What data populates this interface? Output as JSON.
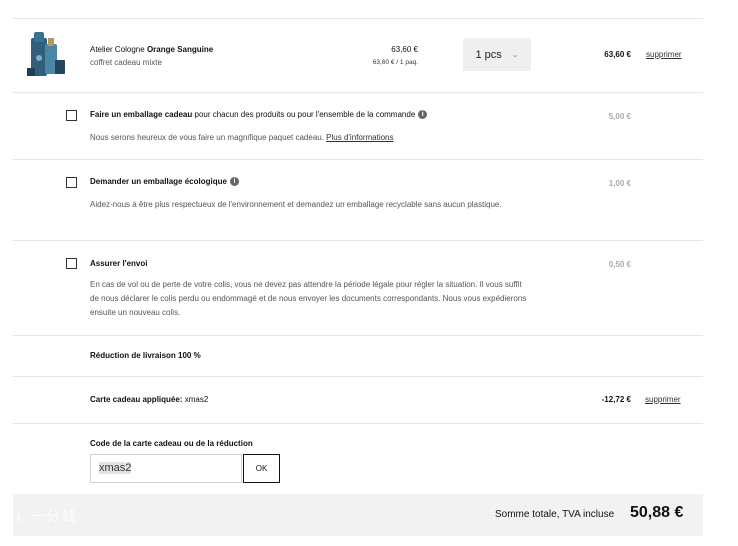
{
  "product": {
    "brand": "Atelier Cologne",
    "name": "Orange Sanguine",
    "subtitle": "coffret cadeau mixte",
    "unit_price": "63,60 €",
    "unit_price_detail": "63,60 € / 1 paq.",
    "quantity": "1 pcs",
    "line_total": "63,60 €",
    "remove_label": "supprimer"
  },
  "options": [
    {
      "title": "Faire un emballage cadeau",
      "title_rest": " pour chacun des produits ou pour l'ensemble de la commande",
      "description": "Nous serons heureux de vous faire un magnifique paquet cadeau.",
      "link": "Plus d'informations",
      "price": "5,00 €"
    },
    {
      "title": "Demander un emballage écologique",
      "description": "Aidez-nous à être plus respectueux de l'environnement et demandez un emballage recyclable sans aucun plastique.",
      "price": "1,00 €"
    },
    {
      "title": "Assurer l'envoi",
      "description": "En cas de vol ou de perte de votre colis, vous ne devez pas attendre la période légale pour régler la situation. Il vous suffit de nous déclarer le colis perdu ou endommagé et de nous envoyer les documents correspondants. Nous vous expédierons ensuite un nouveau colis.",
      "price": "0,50 €"
    }
  ],
  "shipping_discount": "Réduction de livraison 100 %",
  "gift_card": {
    "label": "Carte cadeau appliquée:",
    "code": "xmas2",
    "amount": "-12,72 €",
    "remove_label": "supprimer"
  },
  "code_entry": {
    "label": "Code de la carte cadeau ou de la réduction",
    "value": "xmas2",
    "ok_label": "OK"
  },
  "total": {
    "label": "Somme totale, TVA incluse",
    "value": "50,88 €"
  },
  "watermark": "⤓ 一分钱",
  "info_icon": "info-icon"
}
